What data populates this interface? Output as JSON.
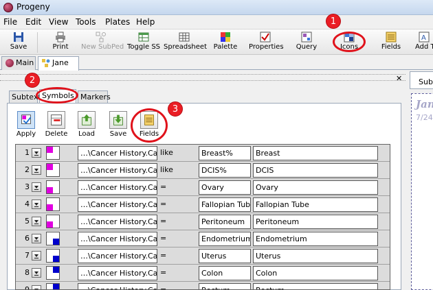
{
  "window": {
    "title": "Progeny"
  },
  "menu": [
    "File",
    "Edit",
    "View",
    "Tools",
    "Plates",
    "Help"
  ],
  "toolbar": {
    "save": "Save",
    "print": "Print",
    "new_subped": "New SubPed",
    "toggle_ss": "Toggle SS",
    "spreadsheet": "Spreadsheet",
    "palette": "Palette",
    "properties": "Properties",
    "query": "Query",
    "icons": "Icons",
    "fields": "Fields",
    "add": "Add T"
  },
  "doc_tabs": [
    "Main",
    "Jane"
  ],
  "sub_tabs": [
    "Subtext",
    "Symbols",
    "Markers"
  ],
  "symbol_toolbar": [
    "Apply",
    "Delete",
    "Load",
    "Save",
    "Fields"
  ],
  "callouts": [
    "1",
    "2",
    "3"
  ],
  "right_panel": {
    "tab": "Subt",
    "name": "Jan",
    "date": "7/24."
  },
  "rows": [
    {
      "num": "1",
      "field": "…\\Cancer History.Cancer",
      "op": "like",
      "value": "Breast%",
      "label": "Breast"
    },
    {
      "num": "2",
      "field": "…\\Cancer History.Cancer",
      "op": "like",
      "value": "DCIS%",
      "label": "DCIS"
    },
    {
      "num": "3",
      "field": "…\\Cancer History.Cancer",
      "op": "=",
      "value": "Ovary",
      "label": "Ovary"
    },
    {
      "num": "4",
      "field": "…\\Cancer History.Cancer",
      "op": "=",
      "value": "Fallopian Tube",
      "label": "Fallopian Tube"
    },
    {
      "num": "5",
      "field": "…\\Cancer History.Cancer",
      "op": "=",
      "value": "Peritoneum",
      "label": "Peritoneum"
    },
    {
      "num": "6",
      "field": "…\\Cancer History.Cancer",
      "op": "=",
      "value": "Endometrium",
      "label": "Endometrium"
    },
    {
      "num": "7",
      "field": "…\\Cancer History.Cancer",
      "op": "=",
      "value": "Uterus",
      "label": "Uterus"
    },
    {
      "num": "8",
      "field": "…\\Cancer History.Cancer",
      "op": "=",
      "value": "Colon",
      "label": "Colon"
    },
    {
      "num": "9",
      "field": "…\\Cancer History.Cancer",
      "op": "=",
      "value": "Rectum",
      "label": "Rectum"
    }
  ],
  "colors": {
    "magenta": "#e000e0",
    "blue": "#0000cc",
    "callout_red": "#e0121b"
  }
}
